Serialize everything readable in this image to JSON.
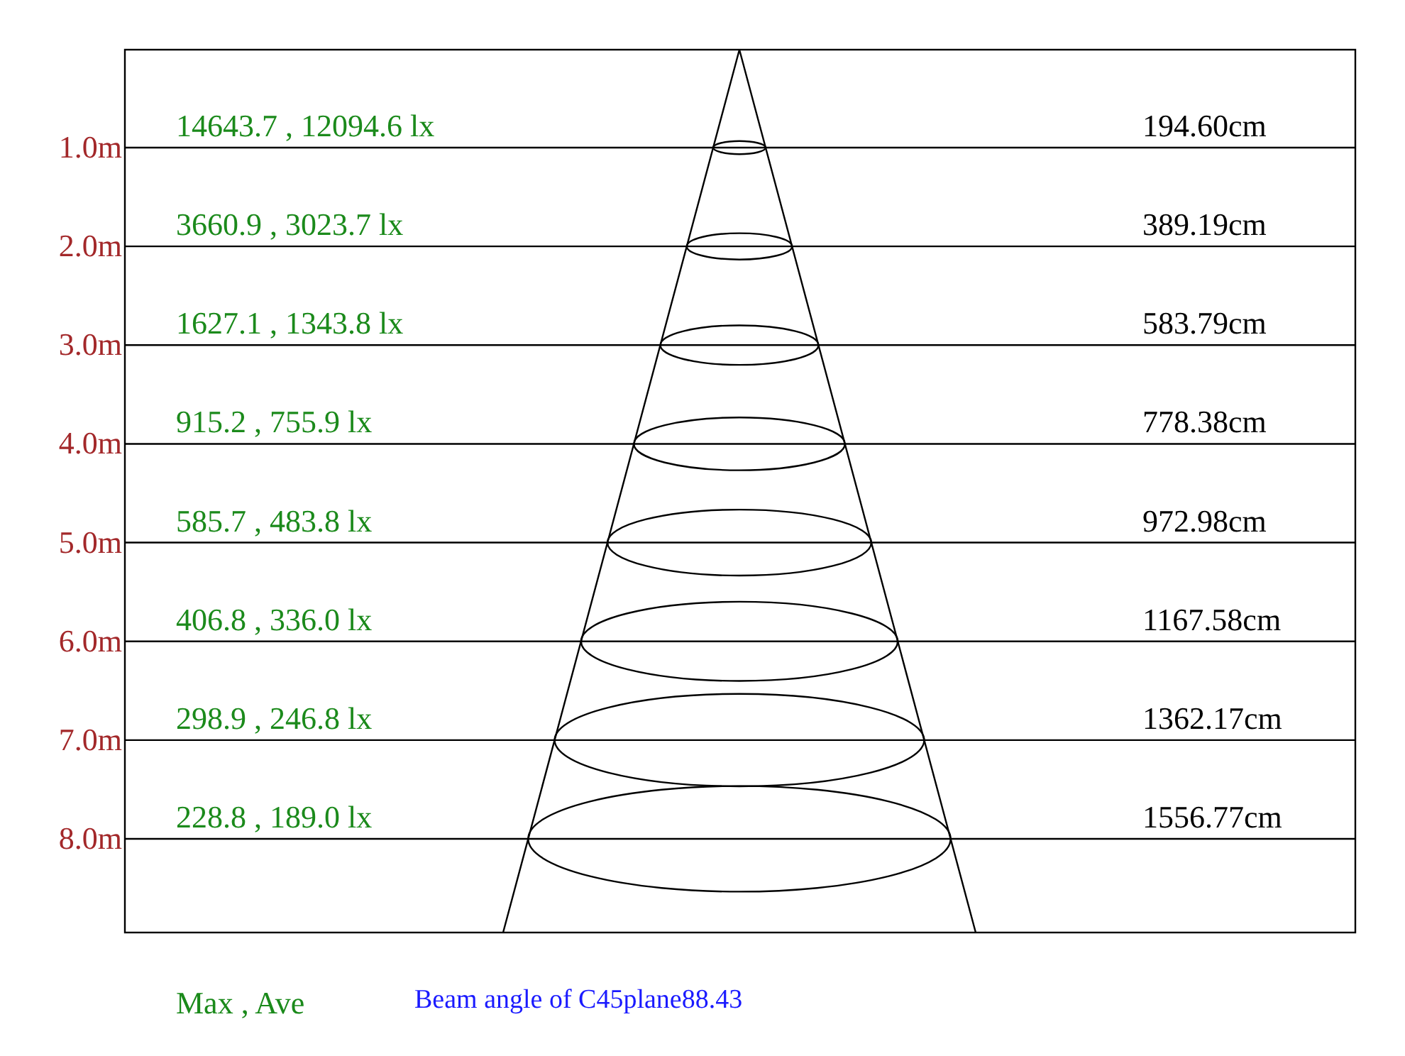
{
  "rows": [
    {
      "distance": "1.0m",
      "illuminance": "14643.7 , 12094.6 lx",
      "diameter": "194.60cm"
    },
    {
      "distance": "2.0m",
      "illuminance": "3660.9 , 3023.7 lx",
      "diameter": "389.19cm"
    },
    {
      "distance": "3.0m",
      "illuminance": "1627.1 , 1343.8 lx",
      "diameter": "583.79cm"
    },
    {
      "distance": "4.0m",
      "illuminance": "915.2 , 755.9 lx",
      "diameter": "778.38cm"
    },
    {
      "distance": "5.0m",
      "illuminance": "585.7 , 483.8 lx",
      "diameter": "972.98cm"
    },
    {
      "distance": "6.0m",
      "illuminance": "406.8 , 336.0 lx",
      "diameter": "1167.58cm"
    },
    {
      "distance": "7.0m",
      "illuminance": "298.9 , 246.8 lx",
      "diameter": "1362.17cm"
    },
    {
      "distance": "8.0m",
      "illuminance": "228.8 , 189.0 lx",
      "diameter": "1556.77cm"
    }
  ],
  "legend": "Max , Ave",
  "beam_angle": "Beam angle of C45plane88.43"
}
